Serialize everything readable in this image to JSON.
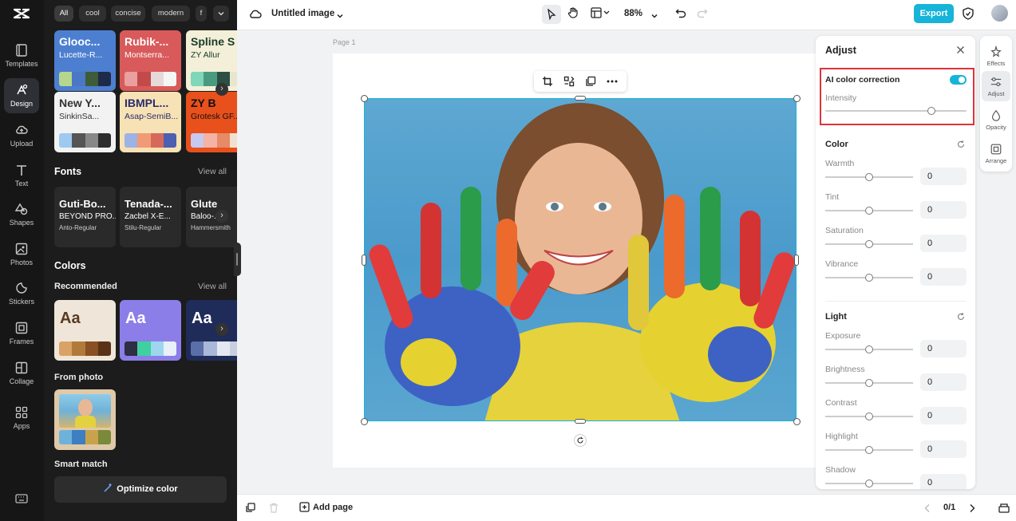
{
  "rail": {
    "items": [
      {
        "label": "Templates",
        "icon": "templates-icon"
      },
      {
        "label": "Design",
        "icon": "design-icon"
      },
      {
        "label": "Upload",
        "icon": "upload-icon"
      },
      {
        "label": "Text",
        "icon": "text-icon"
      },
      {
        "label": "Shapes",
        "icon": "shapes-icon"
      },
      {
        "label": "Photos",
        "icon": "photos-icon"
      },
      {
        "label": "Stickers",
        "icon": "stickers-icon"
      },
      {
        "label": "Frames",
        "icon": "frames-icon"
      },
      {
        "label": "Collage",
        "icon": "collage-icon"
      },
      {
        "label": "Apps",
        "icon": "apps-icon"
      }
    ]
  },
  "panel": {
    "filters": [
      "All",
      "cool",
      "concise",
      "modern",
      "f"
    ],
    "style_cards": [
      {
        "t1": "Glooc...",
        "t2": "Lucette-R...",
        "bg": "#4d7fd0",
        "fg": "#fff",
        "colors": [
          "#b6d68d",
          "#4a78c4",
          "#3e5b3a",
          "#1e2b48"
        ]
      },
      {
        "t1": "Rubik-...",
        "t2": "Montserra...",
        "bg": "#d95a5a",
        "fg": "#fff",
        "colors": [
          "#e8a0a0",
          "#c34a4a",
          "#e6d9d9",
          "#f5f5f5"
        ]
      },
      {
        "t1": "Spline S",
        "t2": "ZY Allur",
        "bg": "#f3efd8",
        "fg": "#1a3a2a",
        "colors": [
          "#7fd6b8",
          "#4a9a80",
          "#2c4f43",
          "#e9e6d0"
        ]
      },
      {
        "t1": "New Y...",
        "t2": "SinkinSa...",
        "bg": "#f2f2f2",
        "fg": "#333",
        "colors": [
          "#9ec9f0",
          "#555",
          "#888",
          "#2d2d2d"
        ]
      },
      {
        "t1": "IBMPL...",
        "t2": "Asap-SemiB...",
        "bg": "#f6e2b4",
        "fg": "#2b2b6e",
        "colors": [
          "#9db3e6",
          "#f19a76",
          "#d66a5a",
          "#4d5fb0"
        ]
      },
      {
        "t1": "ZY B",
        "t2": "Grotesk GF...",
        "bg": "#e8501c",
        "fg": "#111",
        "colors": [
          "#c7c9ee",
          "#f3b3a5",
          "#e78a66",
          "#f3e1d0"
        ]
      }
    ],
    "fonts_title": "Fonts",
    "fonts_view_all": "View all",
    "font_cards": [
      {
        "t1": "Guti-Bo...",
        "t2": "BEYOND PRO...",
        "t3": "Anto-Regular"
      },
      {
        "t1": "Tenada-...",
        "t2": "Zacbel X-E...",
        "t3": "Stilu-Regular"
      },
      {
        "t1": "Glute",
        "t2": "Baloo-...",
        "t3": "Hammersmith"
      }
    ],
    "colors_title": "Colors",
    "recommended_title": "Recommended",
    "recommended_view_all": "View all",
    "color_cards": [
      {
        "label": "Aa",
        "bg": "#efe6d9",
        "fg": "#5a3a22",
        "colors": [
          "#d9a266",
          "#b07b3a",
          "#8a4f22",
          "#5a3218"
        ]
      },
      {
        "label": "Aa",
        "bg": "#8c7ee8",
        "fg": "#ffffff",
        "colors": [
          "#2e2e44",
          "#3fd0a0",
          "#9ed6f0",
          "#e8f0f8"
        ]
      },
      {
        "label": "Aa",
        "bg": "#1f2c5a",
        "fg": "#ffffff",
        "colors": [
          "#5a6ea8",
          "#a9b8d8",
          "#e4e8f0",
          "#c8d0e0"
        ]
      }
    ],
    "from_photo_title": "From photo",
    "photo_card_colors": [
      "#6fb2d9",
      "#3d7fc0",
      "#c9a34b",
      "#7a8a3a"
    ],
    "smart_match_title": "Smart match",
    "optimize_label": "Optimize color"
  },
  "topbar": {
    "title": "Untitled image",
    "zoom": "88%",
    "export_label": "Export"
  },
  "canvas": {
    "page_label": "Page 1"
  },
  "adjust": {
    "title": "Adjust",
    "ai_label": "AI color correction",
    "ai_enabled": true,
    "intensity_label": "Intensity",
    "intensity": 0.75,
    "color_title": "Color",
    "color_items": [
      {
        "label": "Warmth",
        "value": "0"
      },
      {
        "label": "Tint",
        "value": "0"
      },
      {
        "label": "Saturation",
        "value": "0"
      },
      {
        "label": "Vibrance",
        "value": "0"
      }
    ],
    "light_title": "Light",
    "light_items": [
      {
        "label": "Exposure",
        "value": "0"
      },
      {
        "label": "Brightness",
        "value": "0"
      },
      {
        "label": "Contrast",
        "value": "0"
      },
      {
        "label": "Highlight",
        "value": "0"
      },
      {
        "label": "Shadow",
        "value": "0"
      }
    ]
  },
  "tabs": [
    {
      "label": "Effects",
      "icon": "effects-icon"
    },
    {
      "label": "Adjust",
      "icon": "adjust-icon"
    },
    {
      "label": "Opacity",
      "icon": "opacity-icon"
    },
    {
      "label": "Arrange",
      "icon": "arrange-icon"
    }
  ],
  "bottombar": {
    "add_page_label": "Add page",
    "page_counter": "0/1"
  },
  "colors": {
    "accent": "#16b4d8",
    "highlight_box": "#e0333a"
  }
}
